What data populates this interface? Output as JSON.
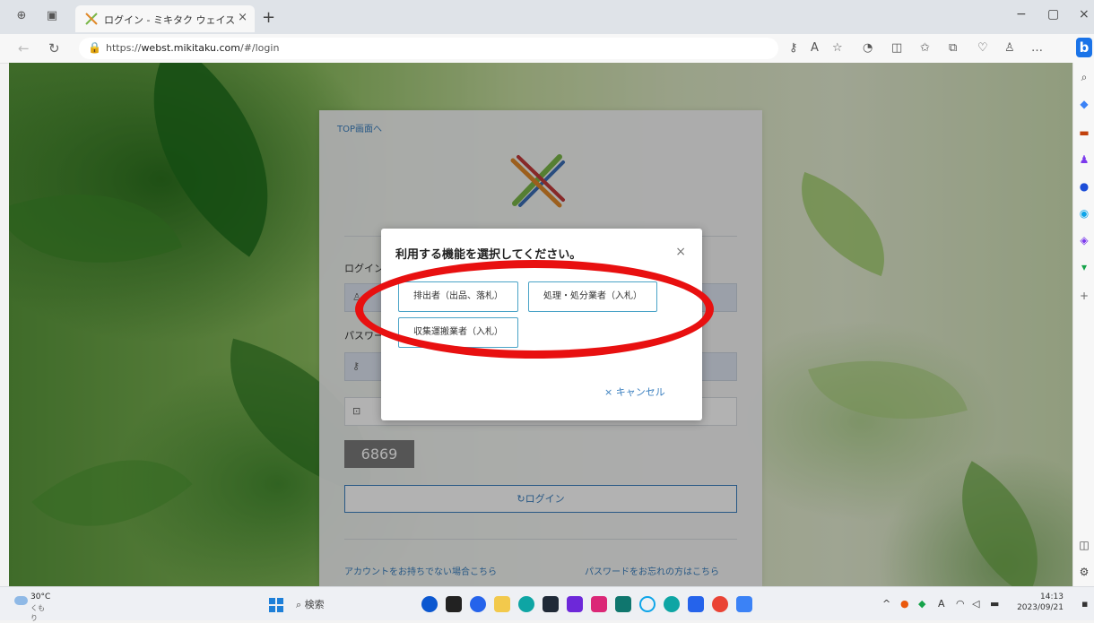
{
  "browser": {
    "tab_title": "ログイン - ミキタク ウェイストオークショ",
    "tab_close": "×",
    "new_tab": "+",
    "url_prefix": "https://",
    "url_host": "webst.mikitaku.com",
    "url_path": "/#/login",
    "window_controls": {
      "minimize": "−",
      "maximize": "▢",
      "close": "×"
    }
  },
  "login_card": {
    "top_link": "TOP画面へ",
    "login_section_label": "ログイン",
    "password_label": "パスワード",
    "captcha_code": "6869",
    "login_button_label": "ログイン",
    "no_account_link": "アカウントをお持ちでない場合こちら",
    "forgot_password_link": "パスワードをお忘れの方はこちら"
  },
  "modal": {
    "title": "利用する機能を選択してください。",
    "close": "×",
    "options": [
      {
        "label": "排出者（出品、落札）"
      },
      {
        "label": "処理・処分業者（入札）"
      },
      {
        "label": "収集運搬業者（入札）"
      }
    ],
    "cancel_label": "キャンセル",
    "cancel_icon": "×"
  },
  "taskbar": {
    "temperature": "30°C",
    "weather_text": "くもり",
    "search_label": "検索",
    "tray_lang": "A",
    "time": "14:13",
    "date": "2023/09/21"
  },
  "colors": {
    "accent": "#3a7fbf",
    "option_border": "#4aa3c7",
    "highlight_ellipse": "#e81010",
    "captcha_bg": "#7a7a7a"
  }
}
